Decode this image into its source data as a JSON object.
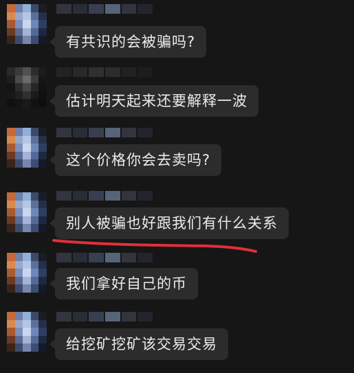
{
  "chat": {
    "messages": [
      {
        "text": "有共识的会被骗吗?"
      },
      {
        "text": "估计明天起来还要解释一波"
      },
      {
        "text": "这个价格你会去卖吗?"
      },
      {
        "text": "别人被骗也好跟我们有什么关系"
      },
      {
        "text": "我们拿好自己的币"
      },
      {
        "text": "给挖矿挖矿该交易交易"
      }
    ]
  },
  "colors": {
    "background": "#161616",
    "bubble": "#2c2c2c",
    "text": "#ececec",
    "annotation_underline": "#e0303a"
  },
  "icons": {
    "avatar": "blurred-avatar",
    "underline": "red-hand-drawn-underline"
  }
}
